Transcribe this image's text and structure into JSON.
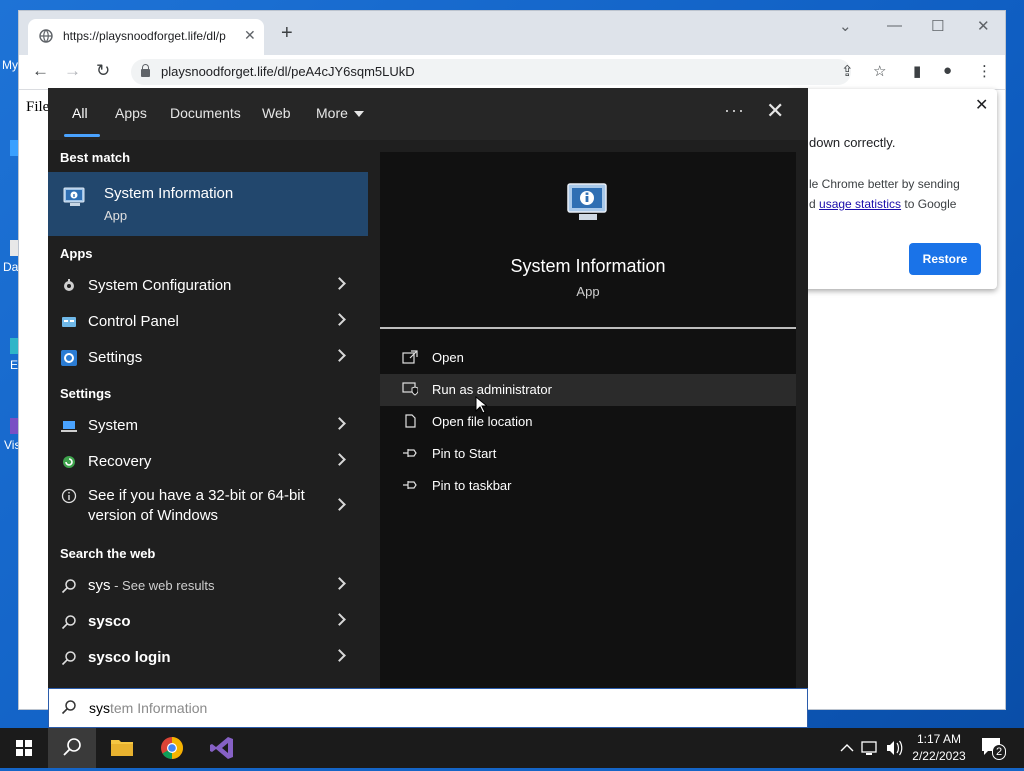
{
  "browser": {
    "tab_title": "https://playsnoodforget.life/dl/p",
    "url": "playsnoodforget.life/dl/peA4cJY6sqm5LUkD",
    "page_text": "File"
  },
  "desktop": {
    "labels": [
      "My",
      "Da",
      "E",
      "Vis"
    ]
  },
  "restore_popup": {
    "line1": "down correctly.",
    "line2": "le Chrome better by sending",
    "line3_prefix": "d ",
    "line3_link": "usage statistics",
    "line3_suffix": " to Google",
    "restore_label": "Restore"
  },
  "search": {
    "tabs": [
      "All",
      "Apps",
      "Documents",
      "Web",
      "More"
    ],
    "active_tab": "All",
    "best_match_header": "Best match",
    "best_match": {
      "name": "System Information",
      "type": "App"
    },
    "apps_header": "Apps",
    "apps": [
      "System Configuration",
      "Control Panel",
      "Settings"
    ],
    "settings_header": "Settings",
    "settings": [
      "System",
      "Recovery",
      "See if you have a 32-bit or 64-bit version of Windows"
    ],
    "web_header": "Search the web",
    "web": [
      {
        "term": "sys",
        "suffix": " - See web results"
      },
      {
        "term": "sysco",
        "suffix": ""
      },
      {
        "term": "sysco login",
        "suffix": ""
      }
    ],
    "preview": {
      "name": "System Information",
      "type": "App"
    },
    "actions": [
      "Open",
      "Run as administrator",
      "Open file location",
      "Pin to Start",
      "Pin to taskbar"
    ],
    "query_typed": "sys",
    "query_ghost": "tem Information"
  },
  "taskbar": {
    "time": "1:17 AM",
    "date": "2/22/2023",
    "notification_count": "2"
  },
  "colors": {
    "accent": "#4aa3ff",
    "best_match_bg": "#22476d",
    "restore_button": "#1a73e8"
  }
}
